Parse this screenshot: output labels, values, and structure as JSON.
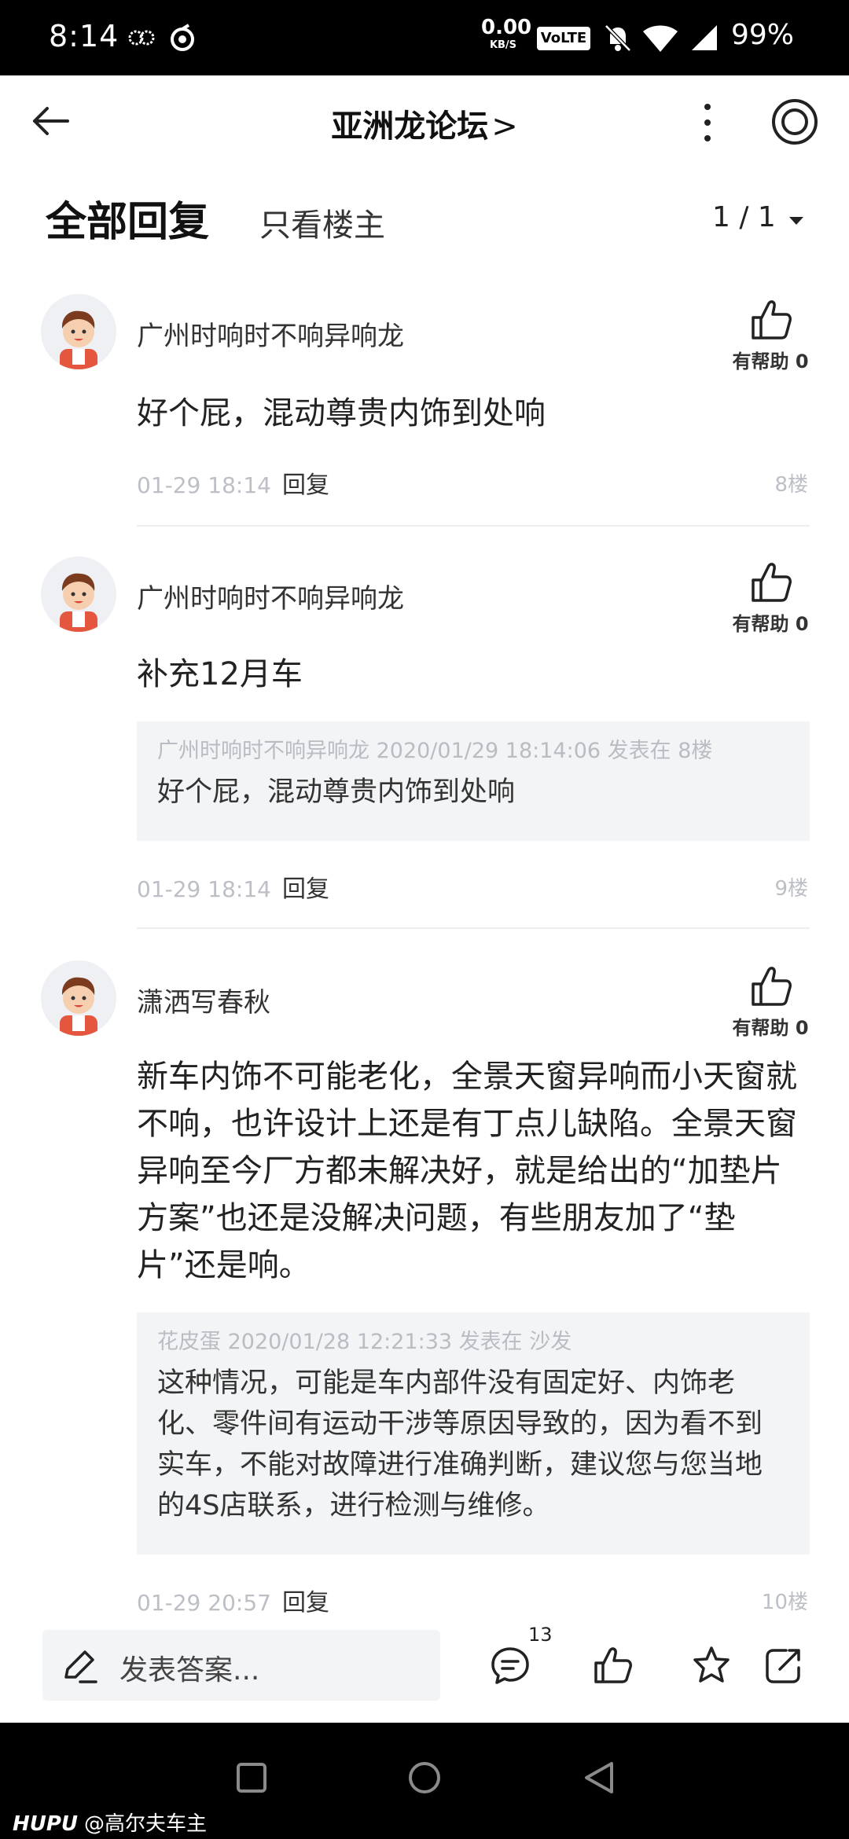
{
  "status_bar": {
    "time": "8:14",
    "net_speed_value": "0.00",
    "net_speed_unit": "KB/S",
    "volte": "VoLTE",
    "battery": "99%"
  },
  "nav": {
    "title": "亚洲龙论坛",
    "title_arrow": ">"
  },
  "tabs": {
    "all_replies": "全部回复",
    "only_op": "只看楼主",
    "pager": "1 / 1"
  },
  "posts": [
    {
      "username": "广州时响时不响异响龙",
      "helpful": "有帮助 0",
      "content": "好个屁，混动尊贵内饰到处响",
      "time": "01-29 18:14",
      "reply": "回复",
      "floor": "8楼"
    },
    {
      "username": "广州时响时不响异响龙",
      "helpful": "有帮助 0",
      "content": "补充12月车",
      "quote_meta": "广州时响时不响异响龙 2020/01/29 18:14:06 发表在 8楼",
      "quote_text": "好个屁，混动尊贵内饰到处响",
      "time": "01-29 18:14",
      "reply": "回复",
      "floor": "9楼"
    },
    {
      "username": "潇洒写春秋",
      "helpful": "有帮助 0",
      "content": "新车内饰不可能老化，全景天窗异响而小天窗就不响，也许设计上还是有丁点儿缺陷。全景天窗异响至今厂方都未解决好，就是给出的“加垫片方案”也还是没解决问题，有些朋友加了“垫片”还是响。",
      "quote_meta": "花皮蛋 2020/01/28 12:21:33 发表在 沙发",
      "quote_text": "这种情况，可能是车内部件没有固定好、内饰老化、零件间有运动干涉等原因导致的，因为看不到实车，不能对故障进行准确判断，建议您与您当地的4S店联系，进行检测与维修。",
      "time": "01-29 20:57",
      "reply": "回复",
      "floor": "10楼"
    }
  ],
  "action_bar": {
    "compose_placeholder": "发表答案...",
    "comment_count": "13"
  },
  "watermark": {
    "brand": "HUPU",
    "user": "@高尔夫车主"
  }
}
